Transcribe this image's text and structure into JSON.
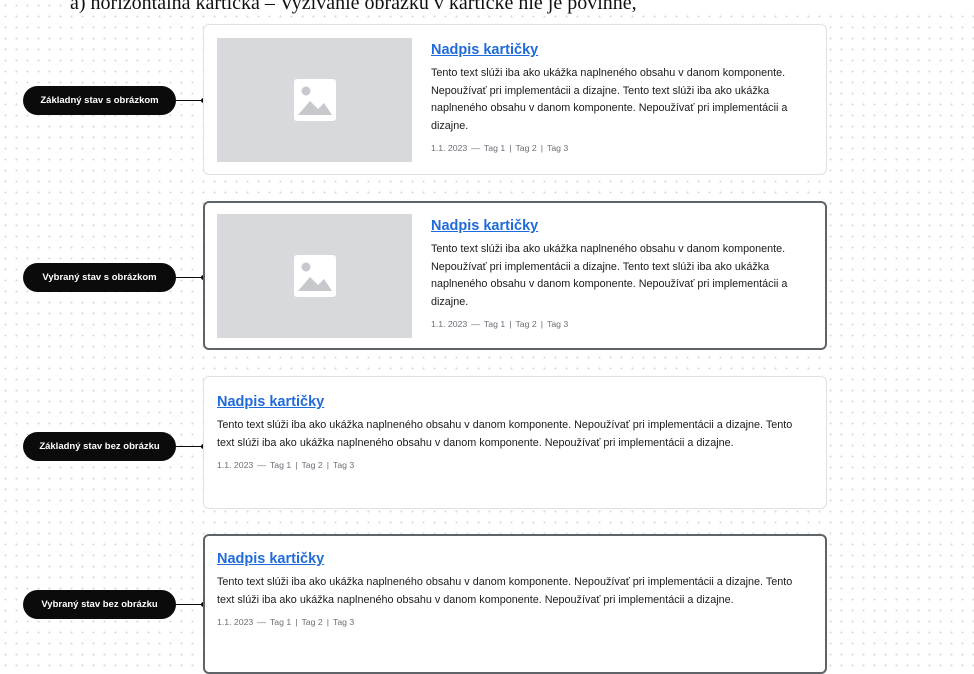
{
  "heading": "a)    horizontálna kartička – Vyžívanie obrázku v kartičke nie je povinné,",
  "meta": {
    "date": "1.1. 2023",
    "dash": "—",
    "tags": [
      "Tag 1",
      "Tag 2",
      "Tag 3"
    ]
  },
  "rows": [
    {
      "label": "Základný stav s obrázkom",
      "card": {
        "title": "Nadpis kartičky",
        "text": "Tento text slúži iba ako ukážka naplneného obsahu v danom komponente. Nepoužívať pri implementácii a dizajne. Tento text slúži iba ako ukážka naplneného obsahu v danom komponente. Nepoužívať pri implementácii a dizajne."
      }
    },
    {
      "label": "Vybraný stav s obrázkom",
      "card": {
        "title": "Nadpis kartičky",
        "text": "Tento text slúži iba ako ukážka naplneného obsahu v danom komponente. Nepoužívať pri implementácii a dizajne. Tento text slúži iba ako ukážka naplneného obsahu v danom komponente. Nepoužívať pri implementácii a dizajne."
      }
    },
    {
      "label": "Základný stav bez obrázku",
      "card": {
        "title": "Nadpis kartičky",
        "text": "Tento text slúži iba ako ukážka naplneného obsahu v danom komponente. Nepoužívať pri implementácii a dizajne. Tento text slúži iba ako ukážka naplneného obsahu v danom komponente. Nepoužívať pri implementácii a dizajne."
      }
    },
    {
      "label": "Vybraný stav bez obrázku",
      "card": {
        "title": "Nadpis kartičky",
        "text": "Tento text slúži iba ako ukážka naplneného obsahu v danom komponente. Nepoužívať pri implementácii a dizajne. Tento text slúži iba ako ukážka naplneného obsahu v danom komponente. Nepoužívať pri implementácii a dizajne."
      }
    }
  ]
}
